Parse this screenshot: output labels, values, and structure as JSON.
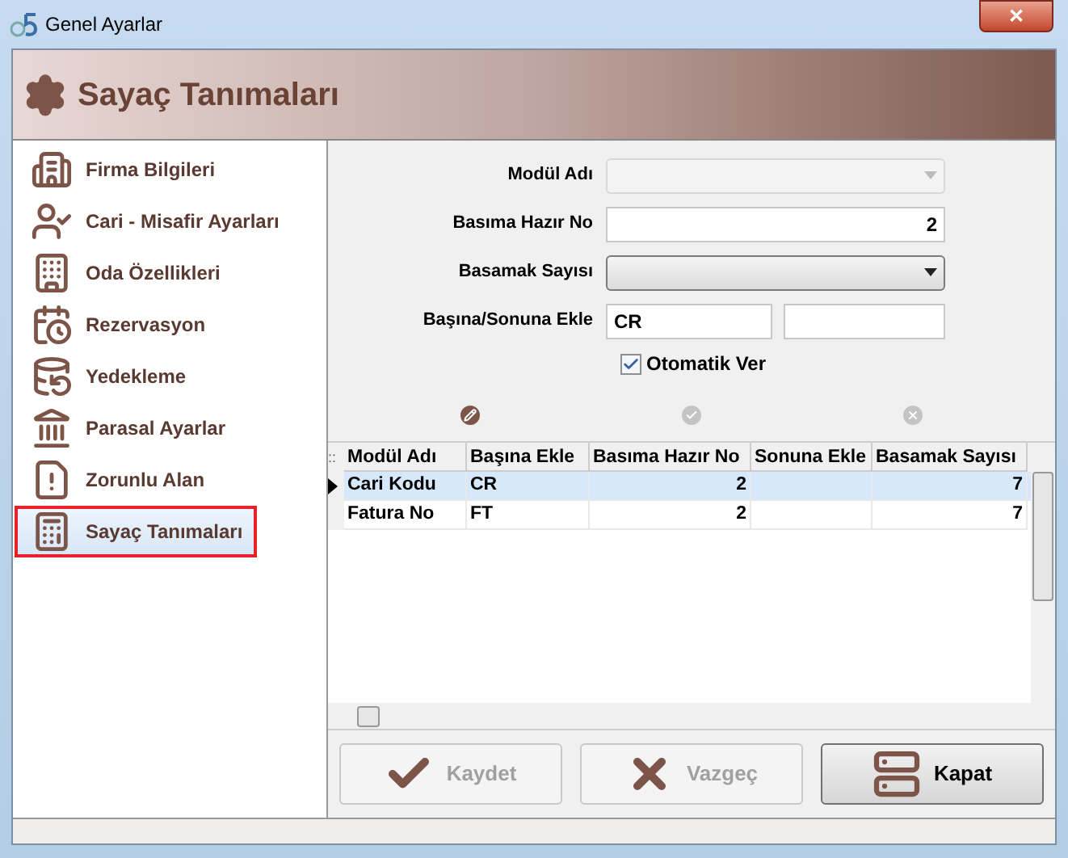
{
  "window": {
    "title": "Genel Ayarlar",
    "close_label": "✕"
  },
  "header": {
    "title": "Sayaç Tanımaları"
  },
  "sidebar": {
    "items": [
      {
        "label": "Firma Bilgileri",
        "selected": false
      },
      {
        "label": "Cari - Misafir Ayarları",
        "selected": false
      },
      {
        "label": "Oda Özellikleri",
        "selected": false
      },
      {
        "label": "Rezervasyon",
        "selected": false
      },
      {
        "label": "Yedekleme",
        "selected": false
      },
      {
        "label": "Parasal Ayarlar",
        "selected": false
      },
      {
        "label": "Zorunlu Alan",
        "selected": false
      },
      {
        "label": "Sayaç Tanımaları",
        "selected": true
      }
    ]
  },
  "form": {
    "fields": [
      {
        "label": "Modül Adı",
        "kind": "dropdown",
        "disabled": true
      },
      {
        "label": "Basıma Hazır No",
        "kind": "number",
        "value": "2"
      },
      {
        "label": "Basamak Sayısı",
        "kind": "dropdown",
        "disabled": false
      },
      {
        "label": "Başına/Sonuna Ekle",
        "kind": "pair",
        "value": "CR"
      }
    ],
    "checkbox": {
      "label": "Otomatik Ver",
      "checked": true
    }
  },
  "grid_actions": [
    {
      "kind": "edit",
      "disabled": false
    },
    {
      "kind": "confirm",
      "disabled": true
    },
    {
      "kind": "cancel",
      "disabled": true
    }
  ],
  "table": {
    "row_selector_label": "::",
    "columns": [
      "Modül Adı",
      "Başına Ekle",
      "Basıma Hazır No",
      "Sonuna Ekle",
      "Basamak Sayısı"
    ],
    "rows": [
      {
        "cells": [
          "Cari Kodu",
          "CR",
          "2",
          "",
          "7"
        ],
        "selected": true
      },
      {
        "cells": [
          "Fatura No",
          "FT",
          "2",
          "",
          "7"
        ],
        "selected": false
      }
    ]
  },
  "buttons": [
    {
      "label": "Kaydet",
      "kind": "save",
      "disabled": true
    },
    {
      "label": "Vazgeç",
      "kind": "cancel",
      "disabled": true
    },
    {
      "label": "Kapat",
      "kind": "close",
      "disabled": false
    }
  ]
}
